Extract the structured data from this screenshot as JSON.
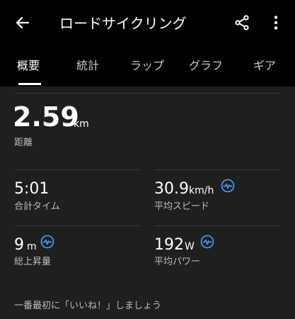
{
  "header": {
    "title": "ロードサイクリング"
  },
  "tabs": [
    {
      "label": "概要",
      "active": true
    },
    {
      "label": "統計",
      "active": false
    },
    {
      "label": "ラップ",
      "active": false
    },
    {
      "label": "グラフ",
      "active": false
    },
    {
      "label": "ギア",
      "active": false
    }
  ],
  "distance": {
    "value": "2.59",
    "unit": "km",
    "label": "距離"
  },
  "metrics": {
    "total_time": {
      "value": "5:01",
      "label": "合計タイム"
    },
    "avg_speed": {
      "value": "30.9",
      "unit": "km/h",
      "label": "平均スピード",
      "icon": "activity-pulse-icon"
    },
    "elevation_gain": {
      "value": "9",
      "unit": "m",
      "label": "総上昇量",
      "icon": "activity-pulse-icon"
    },
    "avg_power": {
      "value": "192",
      "unit": "W",
      "label": "平均パワー",
      "icon": "activity-pulse-icon"
    }
  },
  "social": {
    "like_prompt": "一番最初に「いいね！」しましょう"
  },
  "colors": {
    "background": "#1f1f1f",
    "bar": "#000000",
    "accent": "#4aa3ff",
    "divider": "#3a3a3a"
  }
}
